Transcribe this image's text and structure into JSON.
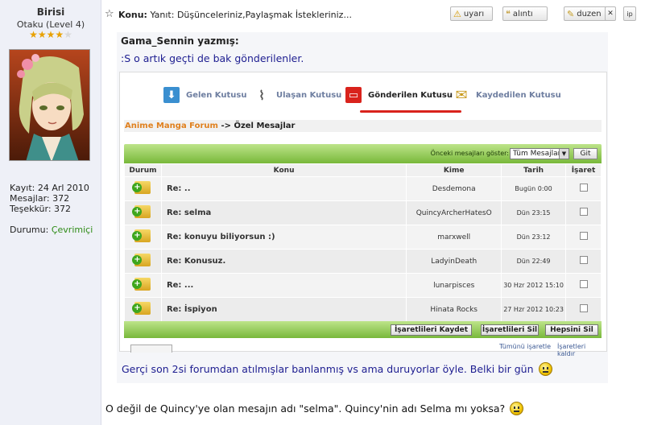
{
  "user": {
    "name": "Birisi",
    "rank": "Otaku (Level 4)",
    "stars_filled": 4,
    "stars_total": 5,
    "stats": {
      "kayit": "Kayıt: 24 Arl 2010",
      "mesajlar": "Mesajlar: 372",
      "tesekkur": "Teşekkür: 372"
    },
    "status_label": "Durumu:",
    "status_value": "Çevrimiçi"
  },
  "post_header": {
    "konu_label": "Konu:",
    "konu_title": "Yanıt: Düşünceleriniz,Paylaşmak İstekleriniz...",
    "buttons": {
      "uyari": "uyarı",
      "alinti": "alıntı",
      "duzen": "duzen",
      "close": "✕",
      "ip": "ip"
    }
  },
  "quote": {
    "author": "Gama_Sennin yazmış:",
    "text_top": ":S o artık geçti de bak gönderilenler.",
    "text_bottom": "Gerçi son 2si forumdan atılmışlar banlanmış vs ama duruyorlar öyle. Belki bir gün"
  },
  "inbox": {
    "tabs": [
      {
        "label": "Gelen Kutusu",
        "icon": "inbox-arrow-icon"
      },
      {
        "label": "Ulaşan Kutusu",
        "icon": "paperclip-icon"
      },
      {
        "label": "Gönderilen Kutusu",
        "icon": "sent-monitor-icon"
      },
      {
        "label": "Kaydedilen Kutusu",
        "icon": "envelope-icon"
      }
    ],
    "breadcrumb_forum": "Anime Manga Forum",
    "breadcrumb_sep": "->",
    "breadcrumb_page": "Özel Mesajlar",
    "filter_label": "Önceki mesajları göster:",
    "filter_value": "Tüm Mesajlar",
    "go_label": "Git",
    "columns": [
      "Durum",
      "Konu",
      "Kime",
      "Tarih",
      "İşaret"
    ],
    "rows": [
      {
        "konu": "Re: ..",
        "kime": "Desdemona",
        "tarih": "Bugün 0:00"
      },
      {
        "konu": "Re: selma",
        "kime": "QuincyArcherHatesO",
        "tarih": "Dün 23:15"
      },
      {
        "konu": "Re: konuyu biliyorsun :)",
        "kime": "marxwell",
        "tarih": "Dün 23:12"
      },
      {
        "konu": "Re: Konusuz.",
        "kime": "LadyinDeath",
        "tarih": "Dün 22:49"
      },
      {
        "konu": "Re: ...",
        "kime": "lunarpisces",
        "tarih": "30 Hzr 2012 15:10"
      },
      {
        "konu": "Re: İspiyon",
        "kime": "Hinata Rocks",
        "tarih": "27 Hzr 2012 10:23"
      }
    ],
    "actions": {
      "save": "İşaretlileri Kaydet",
      "delete": "İşaretlileri Sil",
      "delete_all": "Hepsini Sil"
    },
    "links": {
      "mark_all": "Tümünü işaretle",
      "unmark": "İşaretleri kaldır"
    }
  },
  "post_text": "O değil de Quincy'ye olan mesajın adı \"selma\". Quincy'nin adı Selma mı yoksa?",
  "colors": {
    "link_orange": "#e0801e",
    "quote_blue": "#1d1d90",
    "green_bar": "#78b83a",
    "sent_tab_red": "#d9231c",
    "online_green": "#2e8b16"
  }
}
